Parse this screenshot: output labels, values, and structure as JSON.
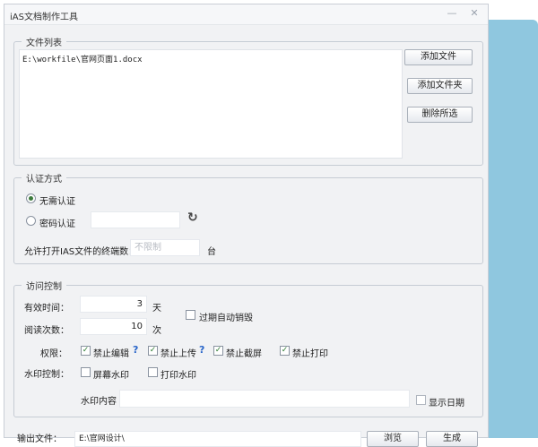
{
  "window": {
    "title": "iAS文档制作工具",
    "minimize": "—",
    "close": "✕"
  },
  "file_list": {
    "legend": "文件列表",
    "items": [
      "E:\\workfile\\官网页面1.docx"
    ],
    "buttons": {
      "add_file": "添加文件",
      "add_folder": "添加文件夹",
      "delete_selected": "删除所选"
    }
  },
  "auth": {
    "legend": "认证方式",
    "options": [
      {
        "label": "无需认证",
        "selected": true
      },
      {
        "label": "密码认证",
        "selected": false
      }
    ],
    "password_value": "",
    "refresh_icon": "↻",
    "max_terminals_label": "允许打开IAS文件的终端数：",
    "max_terminals_placeholder": "不限制",
    "unit": "台"
  },
  "access": {
    "legend": "访问控制",
    "validity_label": "有效时间：",
    "validity_value": "3",
    "validity_unit": "天",
    "auto_destroy_label": "过期自动销毁",
    "reads_label": "阅读次数：",
    "reads_value": "10",
    "reads_unit": "次",
    "permissions_label": "权限：",
    "permissions": [
      {
        "label": "禁止编辑",
        "checked": true,
        "help": "?"
      },
      {
        "label": "禁止上传",
        "checked": true,
        "help": "?"
      },
      {
        "label": "禁止截屏",
        "checked": true
      },
      {
        "label": "禁止打印",
        "checked": true
      }
    ],
    "watermark_label": "水印控制：",
    "screen_watermark": "屏幕水印",
    "print_watermark": "打印水印",
    "watermark_content_label": "水印内容",
    "watermark_content_value": "",
    "show_date": "显示日期"
  },
  "output": {
    "label": "输出文件：",
    "path_value": "E:\\官网设计\\",
    "browse_label": "浏览",
    "generate_label": "生成"
  },
  "colors": {
    "accent_blue": "#8fc7df",
    "check_green": "#2e7d32",
    "help_blue": "#2a66c9"
  }
}
